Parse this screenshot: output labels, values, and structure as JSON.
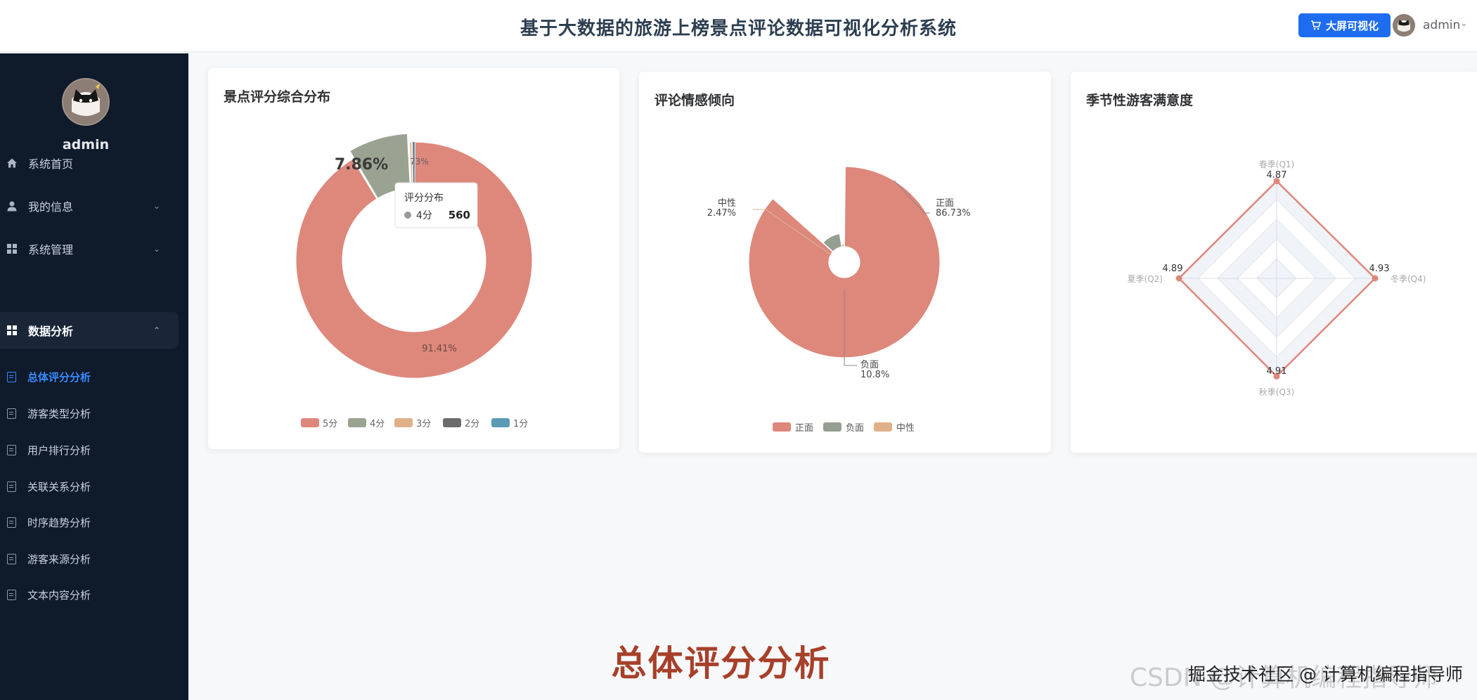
{
  "header": {
    "title": "基于大数据的旅游上榜景点评论数据可视化分析系统",
    "bigscreen_label": "大屏可视化",
    "username": "admin"
  },
  "sidebar": {
    "username": "admin",
    "menu": [
      {
        "label": "系统首页",
        "icon": "home-icon"
      },
      {
        "label": "我的信息",
        "icon": "user-icon"
      },
      {
        "label": "系统管理",
        "icon": "grid-icon"
      },
      {
        "label": "数据分析",
        "icon": "grid-icon"
      }
    ],
    "submenu": [
      {
        "label": "总体评分分析"
      },
      {
        "label": "游客类型分析"
      },
      {
        "label": "用户排行分析"
      },
      {
        "label": "关联关系分析"
      },
      {
        "label": "时序趋势分析"
      },
      {
        "label": "游客来源分析"
      },
      {
        "label": "文本内容分析"
      }
    ]
  },
  "cards": {
    "rating": {
      "title": "景点评分综合分布"
    },
    "sentiment": {
      "title": "评论情感倾向"
    },
    "seasonal": {
      "title": "季节性游客满意度"
    }
  },
  "chart_data": [
    {
      "type": "pie",
      "title": "景点评分综合分布",
      "categories": [
        "5分",
        "4分",
        "3分",
        "2分",
        "1分"
      ],
      "values_percent": [
        91.41,
        7.86,
        0.54,
        0.1,
        0.09
      ],
      "colors": [
        "#de877b",
        "#9aa392",
        "#e0b088",
        "#6b6b6b",
        "#5a9bb5"
      ],
      "slice_labels": [
        "91.41%",
        "7.86%",
        "73%"
      ],
      "legend": "bottom",
      "tooltip": {
        "title": "评分分布",
        "name": "4分",
        "value": "560"
      }
    },
    {
      "type": "pie",
      "title": "评论情感倾向",
      "categories": [
        "正面",
        "负面",
        "中性"
      ],
      "values_percent": [
        86.73,
        10.8,
        2.47
      ],
      "value_labels": [
        "86.73%",
        "10.8%",
        "2.47%"
      ],
      "colors": [
        "#de877b",
        "#959f91",
        "#e0b088"
      ],
      "legend": "bottom"
    },
    {
      "type": "radar",
      "title": "季节性游客满意度",
      "indicators": [
        "春季(Q1)",
        "冬季(Q4)",
        "秋季(Q3)",
        "夏季(Q2)"
      ],
      "values": [
        4.87,
        4.93,
        4.91,
        4.89
      ],
      "value_labels": [
        "4.87",
        "4.93",
        "4.91",
        "4.89"
      ],
      "color": "#de877b"
    }
  ],
  "caption": "总体评分分析",
  "watermark": "掘金技术社区 @ 计算机编程指导师",
  "watermark_faded": "CSDN @计算机编程指导师"
}
